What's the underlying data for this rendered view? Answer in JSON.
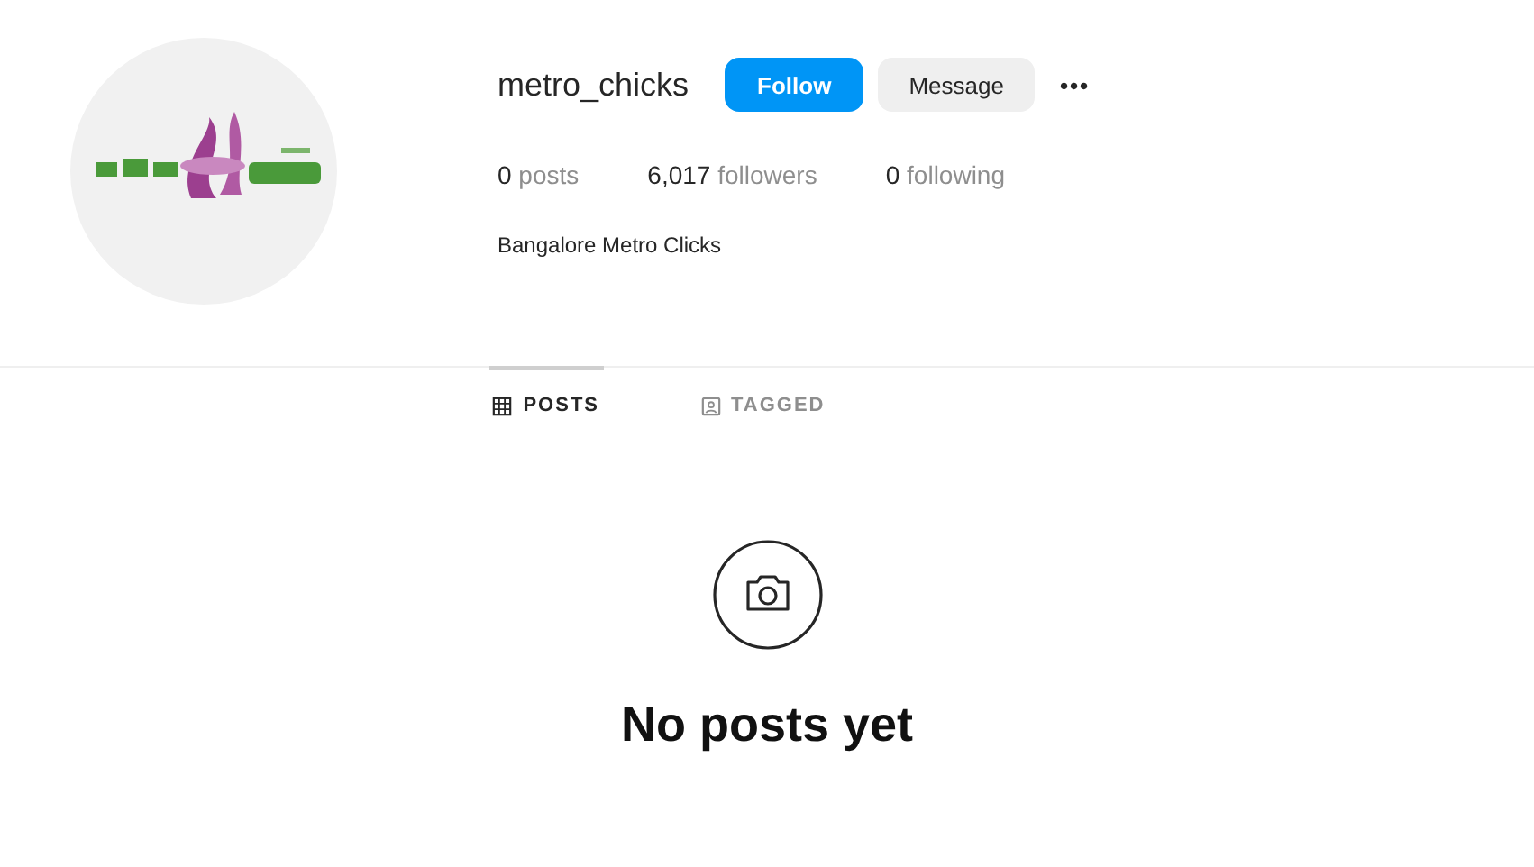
{
  "profile": {
    "username": "metro_chicks",
    "buttons": [
      {
        "label": "Follow",
        "kind": "primary"
      },
      {
        "label": "Message",
        "kind": "secondary"
      }
    ],
    "more": "•••",
    "stats": [
      {
        "count": "0",
        "label": "posts"
      },
      {
        "count": "6,017",
        "label": "followers"
      },
      {
        "count": "0",
        "label": "following"
      }
    ],
    "bio": "Bangalore Metro Clicks"
  },
  "tabs": [
    {
      "label": "POSTS",
      "kind": "grid",
      "selected": true
    },
    {
      "label": "TAGGED",
      "kind": "tag",
      "selected": false
    }
  ],
  "empty": {
    "title": "No posts yet"
  }
}
